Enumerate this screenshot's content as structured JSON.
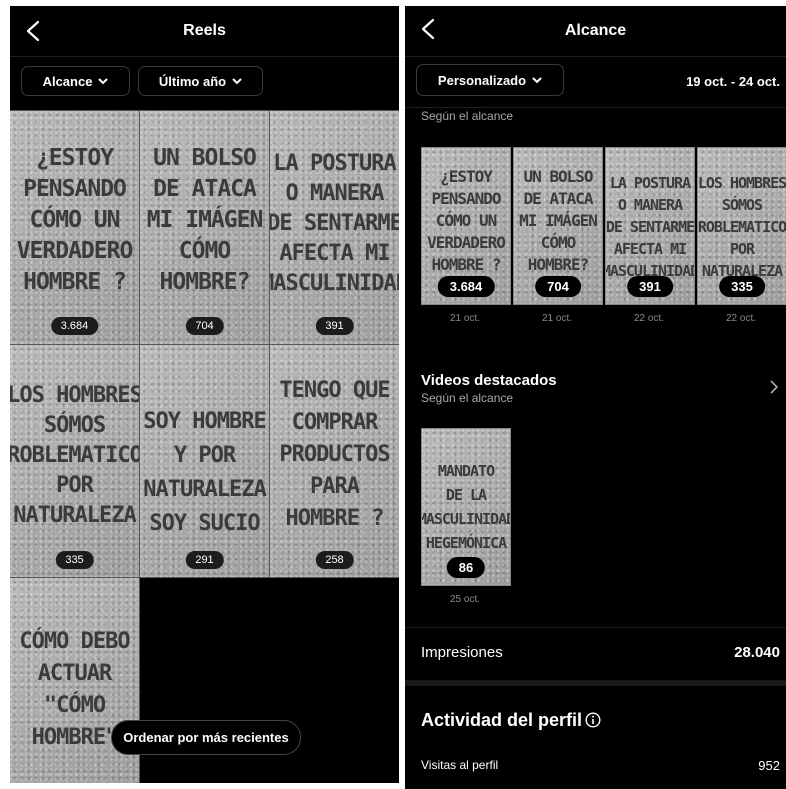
{
  "left": {
    "title": "Reels",
    "filters": [
      {
        "label": "Alcance"
      },
      {
        "label": "Último año"
      }
    ],
    "reels": [
      {
        "text": "¿ESTOY\nPENSANDO\nCÓMO UN\nVERDADERO\nHOMBRE ?",
        "count": "3.684"
      },
      {
        "text": "UN BOLSO\nDE ATACA\nMI IMÁGEN\nCÓMO\nHOMBRE?",
        "count": "704"
      },
      {
        "text": "LA POSTURA\nO MANERA\nDE SENTARME\nAFECTA MI\nMASCULINIDAD",
        "count": "391"
      },
      {
        "text": "LOS HOMBRES\nSÓMOS\nPROBLEMATICOS\nPOR\nNATURALEZA",
        "count": "335"
      },
      {
        "text": "SOY HOMBRE\nY POR\nNATURALEZA\nSOY SUCIO",
        "count": "291"
      },
      {
        "text": "TENGO QUE\nCOMPRAR\nPRODUCTOS\nPARA\nHOMBRE ?",
        "count": "258"
      },
      {
        "text": "CÓMO DEBO\nACTUAR\n\"CÓMO\nHOMBRE\"",
        "count": ""
      }
    ],
    "sort_button": "Ordenar por más recientes"
  },
  "right": {
    "title": "Alcance",
    "filter": "Personalizado",
    "date_range": "19 oct. - 24 oct.",
    "top_sub": "Según el alcance",
    "top_reels": [
      {
        "text": "¿ESTOY\nPENSANDO\nCÓMO UN\nVERDADERO\nHOMBRE ?",
        "count": "3.684",
        "date": "21 oct."
      },
      {
        "text": "UN BOLSO\nDE ATACA\nMI IMÁGEN\nCÓMO\nHOMBRE?",
        "count": "704",
        "date": "21 oct."
      },
      {
        "text": "LA POSTURA\nO MANERA\nDE SENTARME\nAFECTA MI\nMASCULINIDAD",
        "count": "391",
        "date": "22 oct."
      },
      {
        "text": "LOS HOMBRES\nSÓMOS\nPROBLEMATICOS\nPOR\nNATURALEZA",
        "count": "335",
        "date": "22 oct."
      }
    ],
    "featured": {
      "title": "Videos destacados",
      "sub": "Según el alcance",
      "items": [
        {
          "text": "MANDATO\nDE LA\nMASCULINIDAD\nHEGEMÓNICA",
          "count": "86",
          "date": "25 oct."
        }
      ]
    },
    "impressions": {
      "label": "Impresiones",
      "value": "28.040"
    },
    "activity": {
      "title": "Actividad del perfil",
      "visits_label": "Visitas al perfil",
      "visits_value": "952"
    }
  },
  "colors": {
    "background": "#000000",
    "badge": "#1c1c1c",
    "subtext": "#a8a8a8"
  },
  "icons": [
    "back-arrow-icon",
    "chevron-down-icon",
    "chevron-right-icon",
    "info-icon"
  ]
}
